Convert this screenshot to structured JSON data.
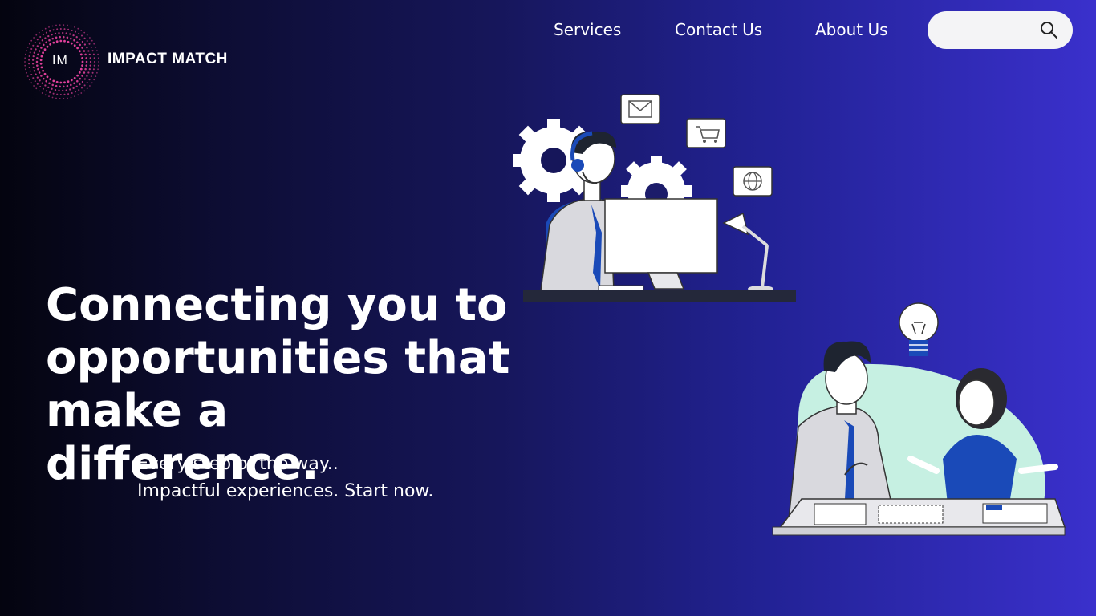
{
  "brand": {
    "initials": "IM",
    "name": "IMPACT MATCH"
  },
  "nav": {
    "items": [
      "Services",
      "Contact Us",
      "About Us"
    ]
  },
  "search": {
    "placeholder": "",
    "value": ""
  },
  "hero": {
    "headline": [
      "Connecting you to",
      "opportunities that make a",
      "difference."
    ],
    "sub": [
      "Every step of the way..",
      "Impactful experiences. Start now."
    ]
  },
  "icons": {
    "search": "search-icon",
    "mail": "mail-icon",
    "cart": "cart-icon",
    "globe": "globe-icon",
    "gear": "gear-icon",
    "lightbulb": "lightbulb-icon"
  },
  "colors": {
    "accent_pink": "#e0409a",
    "tie_blue": "#1a4ab8",
    "bubble": "#c6f0e2"
  }
}
